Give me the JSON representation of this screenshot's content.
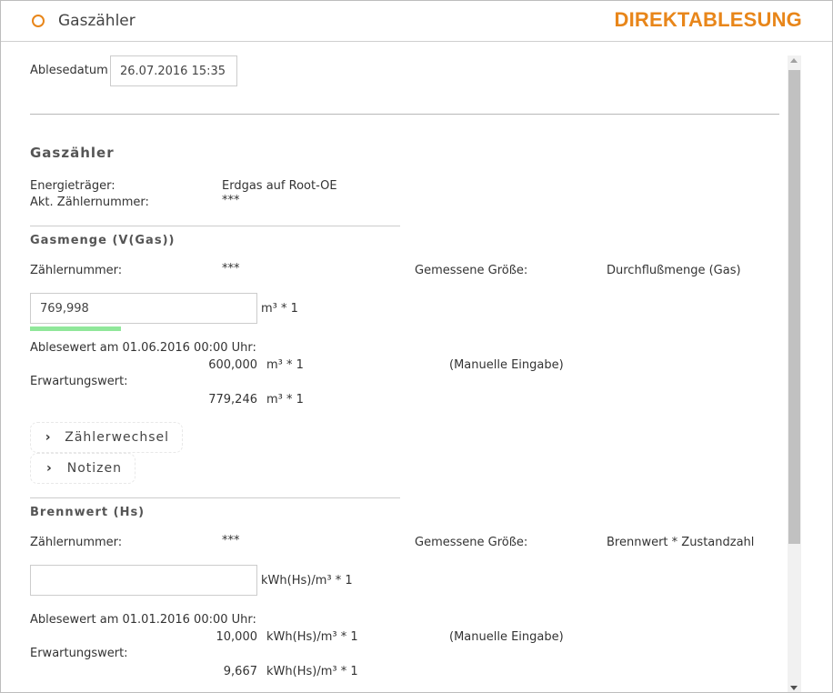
{
  "header": {
    "title": "Gaszähler",
    "mode": "DIREKTABLESUNG"
  },
  "reading_date": {
    "label": "Ablesedatum",
    "value": "26.07.2016 15:35"
  },
  "meter": {
    "heading": "Gaszähler",
    "energy_label": "Energieträger:",
    "energy_value": "Erdgas auf Root-OE",
    "number_label": "Akt. Zählernummer:",
    "number_value": "***"
  },
  "gas_volume": {
    "heading": "Gasmenge (V(Gas))",
    "meter_number_label": "Zählernummer:",
    "meter_number_value": "***",
    "measured_label": "Gemessene Größe:",
    "measured_value": "Durchflußmenge (Gas)",
    "input_value": "769,998",
    "unit": "m³ * 1",
    "progress_fraction": 0.4,
    "last_reading_label": "Ablesewert am 01.06.2016 00:00 Uhr:",
    "last_reading_value": "600,000",
    "last_reading_unit": "m³ * 1",
    "last_reading_source": "(Manuelle Eingabe)",
    "expected_label": "Erwartungswert:",
    "expected_value": "779,246",
    "expected_unit": "m³ * 1",
    "accordion": [
      {
        "label": "Zählerwechsel",
        "icon": "chevron-right-icon"
      },
      {
        "label": "Notizen",
        "icon": "chevron-right-icon"
      }
    ]
  },
  "calorific": {
    "heading": "Brennwert (Hs)",
    "meter_number_label": "Zählernummer:",
    "meter_number_value": "***",
    "measured_label": "Gemessene Größe:",
    "measured_value": "Brennwert * Zustandzahl",
    "input_value": "",
    "unit": "kWh(Hs)/m³ * 1",
    "last_reading_label": "Ablesewert am 01.01.2016 00:00 Uhr:",
    "last_reading_value": "10,000",
    "last_reading_unit": "kWh(Hs)/m³ * 1",
    "last_reading_source": "(Manuelle Eingabe)",
    "expected_label": "Erwartungswert:",
    "expected_value": "9,667",
    "expected_unit": "kWh(Hs)/m³ * 1"
  },
  "colors": {
    "accent": "#e8861a",
    "progress": "#90e79a"
  }
}
